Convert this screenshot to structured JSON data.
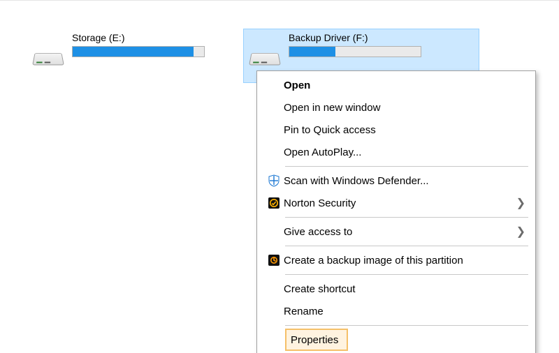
{
  "drives": [
    {
      "label": "Storage (E:)",
      "fill_pct": 92,
      "subtext": "",
      "selected": false
    },
    {
      "label": "Backup Driver (F:)",
      "fill_pct": 35,
      "subtext": "",
      "selected": true
    }
  ],
  "context_menu": {
    "open": "Open",
    "open_new_window": "Open in new window",
    "pin_quick": "Pin to Quick access",
    "open_autoplay": "Open AutoPlay...",
    "defender": "Scan with Windows Defender...",
    "norton": "Norton Security",
    "give_access": "Give access to",
    "backup_image": "Create a backup image of this partition",
    "create_shortcut": "Create shortcut",
    "rename": "Rename",
    "properties": "Properties"
  }
}
